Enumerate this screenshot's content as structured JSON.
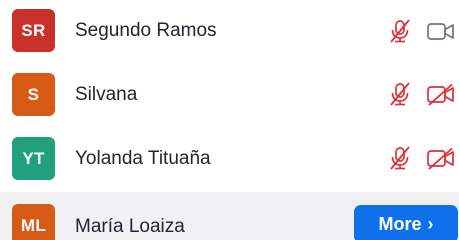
{
  "participants": [
    {
      "initials": "SR",
      "name": "Segundo Ramos",
      "avatar_color": "#c9302c",
      "mic": "muted",
      "video": "on"
    },
    {
      "initials": "S",
      "name": "Silvana",
      "avatar_color": "#d85a17",
      "mic": "muted",
      "video": "off"
    },
    {
      "initials": "YT",
      "name": "Yolanda Tituaña",
      "avatar_color": "#21a07e",
      "mic": "muted",
      "video": "off"
    },
    {
      "initials": "ML",
      "name": "María Loaiza",
      "avatar_color": "#d85a17",
      "hovered": true
    }
  ],
  "more_button": {
    "label": "More",
    "chevron": "›",
    "color": "#0e71eb"
  },
  "colors": {
    "muted_icon": "#e02e36",
    "video_on_icon": "#6e7680",
    "hover_row_bg": "#f1f1f3"
  },
  "icons": {
    "mic_muted": "mic-muted-icon",
    "video_on": "video-camera-icon",
    "video_off": "video-off-icon"
  }
}
